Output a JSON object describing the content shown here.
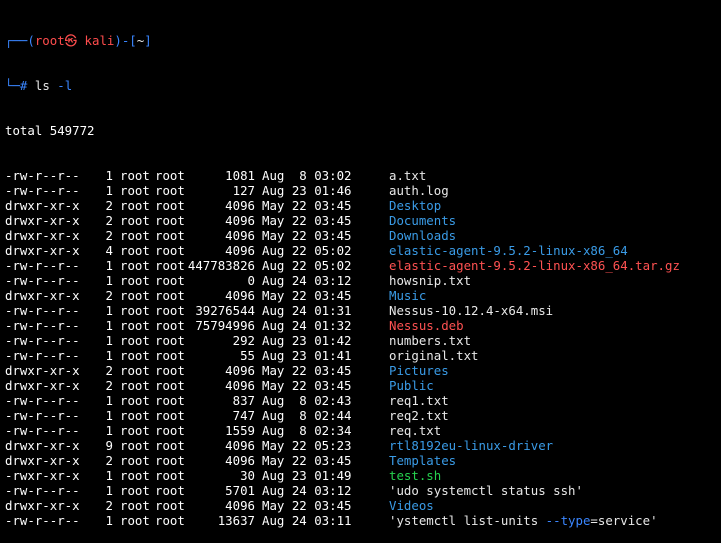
{
  "prompt": {
    "bar_top": "┌──(",
    "user": "root㉿ kali",
    "mid": ")-[",
    "cwd": "~",
    "end": "]",
    "bar_bottom": "└─",
    "hash": "#",
    "command": "ls",
    "option": "-l"
  },
  "total": "total 549772",
  "listing": [
    {
      "perm": "-rw-r--r--",
      "links": "1",
      "owner": "root",
      "group": "root",
      "size": "1081",
      "date": "Aug  8 03:02",
      "name": "a.txt",
      "kind": "file"
    },
    {
      "perm": "-rw-r--r--",
      "links": "1",
      "owner": "root",
      "group": "root",
      "size": "127",
      "date": "Aug 23 01:46",
      "name": "auth.log",
      "kind": "file"
    },
    {
      "perm": "drwxr-xr-x",
      "links": "2",
      "owner": "root",
      "group": "root",
      "size": "4096",
      "date": "May 22 03:45",
      "name": "Desktop",
      "kind": "dir"
    },
    {
      "perm": "drwxr-xr-x",
      "links": "2",
      "owner": "root",
      "group": "root",
      "size": "4096",
      "date": "May 22 03:45",
      "name": "Documents",
      "kind": "dir"
    },
    {
      "perm": "drwxr-xr-x",
      "links": "2",
      "owner": "root",
      "group": "root",
      "size": "4096",
      "date": "May 22 03:45",
      "name": "Downloads",
      "kind": "dir"
    },
    {
      "perm": "drwxr-xr-x",
      "links": "4",
      "owner": "root",
      "group": "root",
      "size": "4096",
      "date": "Aug 22 05:02",
      "name": "elastic-agent-9.5.2-linux-x86_64",
      "kind": "dir"
    },
    {
      "perm": "-rw-r--r--",
      "links": "1",
      "owner": "root",
      "group": "root",
      "size": "447783826",
      "date": "Aug 22 05:02",
      "name": "elastic-agent-9.5.2-linux-x86_64.tar.gz",
      "kind": "archive"
    },
    {
      "perm": "-rw-r--r--",
      "links": "1",
      "owner": "root",
      "group": "root",
      "size": "0",
      "date": "Aug 24 03:12",
      "name": "howsnip.txt",
      "kind": "file"
    },
    {
      "perm": "drwxr-xr-x",
      "links": "2",
      "owner": "root",
      "group": "root",
      "size": "4096",
      "date": "May 22 03:45",
      "name": "Music",
      "kind": "dir"
    },
    {
      "perm": "-rw-r--r--",
      "links": "1",
      "owner": "root",
      "group": "root",
      "size": "39276544",
      "date": "Aug 24 01:31",
      "name": "Nessus-10.12.4-x64.msi",
      "kind": "file"
    },
    {
      "perm": "-rw-r--r--",
      "links": "1",
      "owner": "root",
      "group": "root",
      "size": "75794996",
      "date": "Aug 24 01:32",
      "name": "Nessus.deb",
      "kind": "archive"
    },
    {
      "perm": "-rw-r--r--",
      "links": "1",
      "owner": "root",
      "group": "root",
      "size": "292",
      "date": "Aug 23 01:42",
      "name": "numbers.txt",
      "kind": "file"
    },
    {
      "perm": "-rw-r--r--",
      "links": "1",
      "owner": "root",
      "group": "root",
      "size": "55",
      "date": "Aug 23 01:41",
      "name": "original.txt",
      "kind": "file"
    },
    {
      "perm": "drwxr-xr-x",
      "links": "2",
      "owner": "root",
      "group": "root",
      "size": "4096",
      "date": "May 22 03:45",
      "name": "Pictures",
      "kind": "dir"
    },
    {
      "perm": "drwxr-xr-x",
      "links": "2",
      "owner": "root",
      "group": "root",
      "size": "4096",
      "date": "May 22 03:45",
      "name": "Public",
      "kind": "dir"
    },
    {
      "perm": "-rw-r--r--",
      "links": "1",
      "owner": "root",
      "group": "root",
      "size": "837",
      "date": "Aug  8 02:43",
      "name": "req1.txt",
      "kind": "file"
    },
    {
      "perm": "-rw-r--r--",
      "links": "1",
      "owner": "root",
      "group": "root",
      "size": "747",
      "date": "Aug  8 02:44",
      "name": "req2.txt",
      "kind": "file"
    },
    {
      "perm": "-rw-r--r--",
      "links": "1",
      "owner": "root",
      "group": "root",
      "size": "1559",
      "date": "Aug  8 02:34",
      "name": "req.txt",
      "kind": "file"
    },
    {
      "perm": "drwxr-xr-x",
      "links": "9",
      "owner": "root",
      "group": "root",
      "size": "4096",
      "date": "May 22 05:23",
      "name": "rtl8192eu-linux-driver",
      "kind": "dir"
    },
    {
      "perm": "drwxr-xr-x",
      "links": "2",
      "owner": "root",
      "group": "root",
      "size": "4096",
      "date": "May 22 03:45",
      "name": "Templates",
      "kind": "dir"
    },
    {
      "perm": "-rwxr-xr-x",
      "links": "1",
      "owner": "root",
      "group": "root",
      "size": "30",
      "date": "Aug 23 01:49",
      "name": "test.sh",
      "kind": "exec"
    },
    {
      "perm": "-rw-r--r--",
      "links": "1",
      "owner": "root",
      "group": "root",
      "size": "5701",
      "date": "Aug 24 03:12",
      "name": "'udo systemctl status ssh'",
      "kind": "file"
    },
    {
      "perm": "drwxr-xr-x",
      "links": "2",
      "owner": "root",
      "group": "root",
      "size": "4096",
      "date": "May 22 03:45",
      "name": "Videos",
      "kind": "dir"
    },
    {
      "perm": "-rw-r--r--",
      "links": "1",
      "owner": "root",
      "group": "root",
      "size": "13637",
      "date": "Aug 24 03:11",
      "name_parts": [
        "'ystemctl list-units ",
        "--type",
        "=service'"
      ],
      "kind": "file"
    }
  ],
  "colors": {
    "background": "#000000",
    "text": "#e8e8e8",
    "directory": "#3a9be6",
    "archive": "#ff5252",
    "executable": "#26d14f",
    "prompt_frame": "#3a86ff",
    "prompt_user": "#ff4d4d"
  }
}
